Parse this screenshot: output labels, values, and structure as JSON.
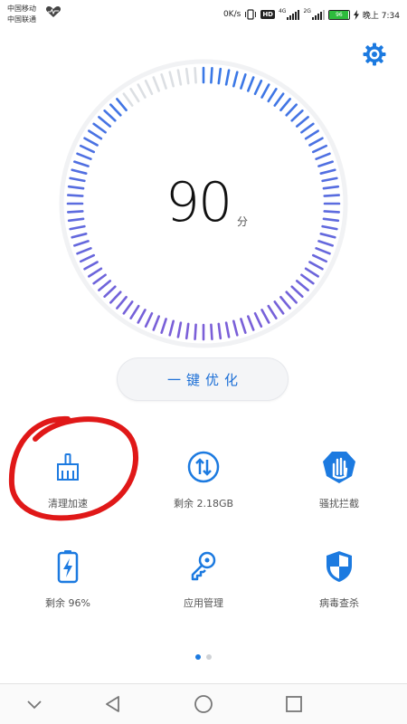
{
  "status_bar": {
    "carrier_1": "中国移动",
    "carrier_2": "中国联通",
    "net_speed": "0K/s",
    "hd_badge": "HD",
    "network_4g": "4G",
    "network_2g": "2G",
    "battery_level": 96,
    "battery_text": "96",
    "time": "晚上 7:34"
  },
  "gauge": {
    "score": "90",
    "unit": "分",
    "score_value": 90,
    "max_value": 100
  },
  "optimize_button": {
    "label": "一键优化"
  },
  "tiles": [
    {
      "label": "清理加速",
      "icon": "broom-icon"
    },
    {
      "label": "剩余 2.18GB",
      "icon": "data-transfer-icon"
    },
    {
      "label": "骚扰拦截",
      "icon": "hand-shield-icon"
    },
    {
      "label": "剩余 96%",
      "icon": "battery-icon"
    },
    {
      "label": "应用管理",
      "icon": "key-icon"
    },
    {
      "label": "病毒查杀",
      "icon": "shield-icon"
    }
  ],
  "pagination": {
    "pages": 2,
    "active": 0
  },
  "colors": {
    "accent": "#1c7ae0",
    "tick_blue": "#3a78e6",
    "tick_purple": "#7b5fd8",
    "tick_grey": "#dcdfe3",
    "annotation": "#e01818",
    "battery_green": "#2dbb3c"
  }
}
